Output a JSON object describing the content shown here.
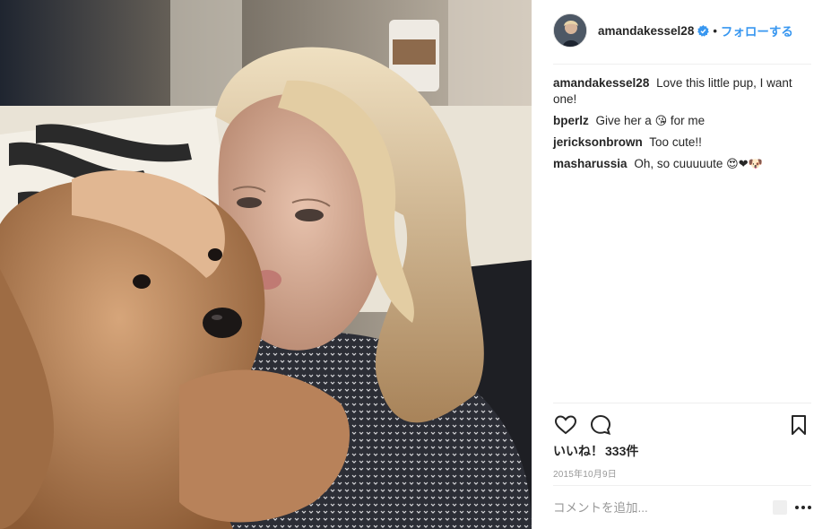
{
  "post": {
    "username": "amandakessel28",
    "dot": "•",
    "follow_label": "フォローする",
    "likes_label": "いいね！",
    "likes_count": "333件",
    "date": "2015年10月9日",
    "add_comment_placeholder": "コメントを追加..."
  },
  "comments": [
    {
      "user": "amandakessel28",
      "text": "Love this little pup, I want one!",
      "emoji": ""
    },
    {
      "user": "bperlz",
      "text": "Give her a",
      "emoji": "😘",
      "text_after": "for me"
    },
    {
      "user": "jericksonbrown",
      "text": "Too cute!!",
      "emoji": ""
    },
    {
      "user": "masharussia",
      "text": "Oh, so cuuuuute",
      "emoji": "😍❤🐶",
      "text_after": ""
    }
  ],
  "icons": {
    "verified": "verified-badge-icon",
    "like": "heart-outline-icon",
    "comment": "speech-bubble-icon",
    "save": "bookmark-icon",
    "more": "ellipsis-icon"
  },
  "colors": {
    "link_blue": "#3897f0",
    "text": "#262626",
    "muted": "#999999",
    "divider": "#efefef"
  }
}
